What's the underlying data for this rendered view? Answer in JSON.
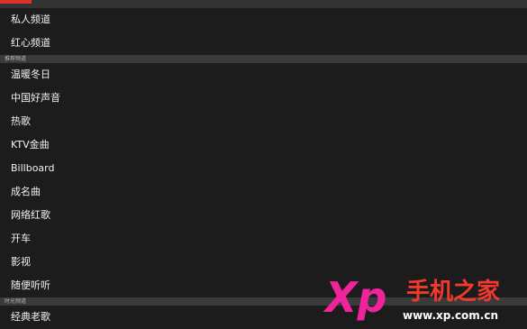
{
  "progress": {
    "fraction": 0.06,
    "color": "#e03131"
  },
  "channels_top": [
    "私人频道",
    "红心频道"
  ],
  "sections": [
    {
      "title": "推荐频道",
      "items": [
        "温暖冬日",
        "中国好声音",
        "热歌",
        "KTV金曲",
        "Billboard",
        "成名曲",
        "网络红歌",
        "开车",
        "影视",
        "随便听听"
      ]
    },
    {
      "title": "时光频道",
      "items": [
        "经典老歌"
      ]
    }
  ],
  "watermark": {
    "logo_text": "Xp",
    "brand": "手机之家",
    "url": "www.xp.com.cn",
    "colors": {
      "x": "#f0239b",
      "p": "#2aa3e8",
      "brand": "#f2392b"
    }
  }
}
